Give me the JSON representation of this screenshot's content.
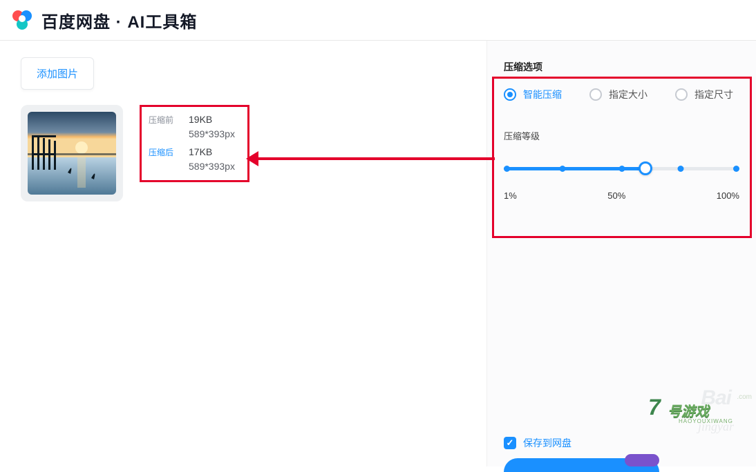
{
  "header": {
    "title": "百度网盘 · AI工具箱"
  },
  "left": {
    "add_image_label": "添加图片",
    "info": {
      "before_label": "压缩前",
      "before_size": "19KB",
      "before_dim": "589*393px",
      "after_label": "压缩后",
      "after_size": "17KB",
      "after_dim": "589*393px"
    }
  },
  "right": {
    "section_title": "压缩选项",
    "radios": {
      "smart": "智能压缩",
      "by_size": "指定大小",
      "by_dim": "指定尺寸",
      "selected": "smart"
    },
    "level_title": "压缩等级",
    "slider": {
      "min_label": "1%",
      "mid_label": "50%",
      "max_label": "100%",
      "value_pct": 60
    },
    "save_checkbox_label": "保存到网盘"
  },
  "watermark": {
    "baidu": "Bai",
    "jy": "jingyar",
    "site_num": "7",
    "site_txt": "号游戏",
    "site_sub": "HAOYOUXIWANG",
    "site_url": ".com"
  }
}
